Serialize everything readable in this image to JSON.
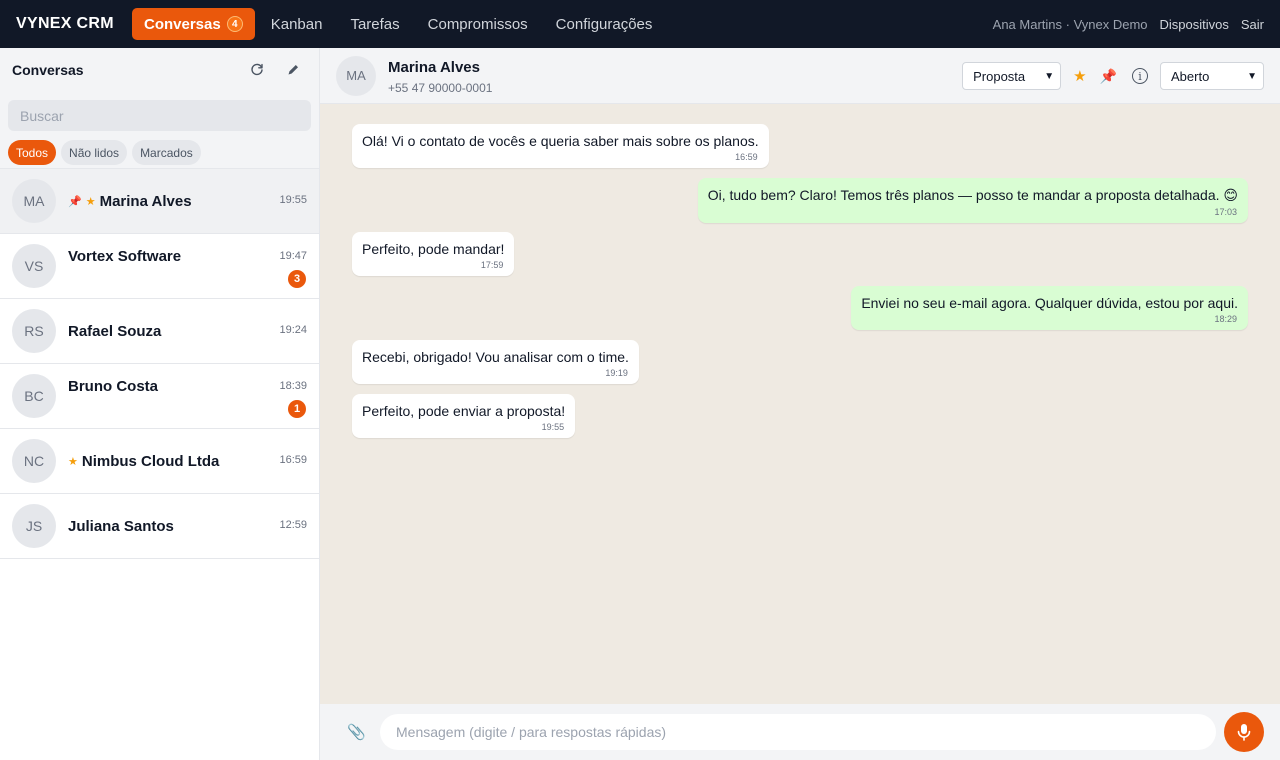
{
  "topbar": {
    "brand": "VYNEX CRM",
    "nav": [
      {
        "label": "Conversas",
        "badge": "4"
      },
      {
        "label": "Kanban"
      },
      {
        "label": "Tarefas"
      },
      {
        "label": "Compromissos"
      },
      {
        "label": "Configurações"
      }
    ],
    "user": "Ana Martins · Vynex Demo",
    "devices": "Dispositivos",
    "logout": "Sair"
  },
  "sidebar": {
    "title": "Conversas",
    "search_placeholder": "Buscar",
    "filters": [
      "Todos",
      "Não lidos",
      "Marcados"
    ],
    "conversations": [
      {
        "initials": "MA",
        "name": "Marina Alves",
        "time": "19:55",
        "pinned": true,
        "starred": true
      },
      {
        "initials": "VS",
        "name": "Vortex Software",
        "time": "19:47",
        "unread": "3"
      },
      {
        "initials": "RS",
        "name": "Rafael Souza",
        "time": "19:24"
      },
      {
        "initials": "BC",
        "name": "Bruno Costa",
        "time": "18:39",
        "unread": "1"
      },
      {
        "initials": "NC",
        "name": "Nimbus Cloud Ltda",
        "time": "16:59",
        "starred": true
      },
      {
        "initials": "JS",
        "name": "Juliana Santos",
        "time": "12:59"
      }
    ]
  },
  "chat": {
    "contact": {
      "initials": "MA",
      "name": "Marina Alves",
      "phone": "+55 47 90000-0001"
    },
    "stage": "Proposta",
    "status": "Aberto",
    "messages": [
      {
        "dir": "in",
        "text": "Olá! Vi o contato de vocês e queria saber mais sobre os planos.",
        "time": "16:59"
      },
      {
        "dir": "out",
        "text": "Oi, tudo bem? Claro! Temos três planos — posso te mandar a proposta detalhada. 😊",
        "time": "17:03"
      },
      {
        "dir": "in",
        "text": "Perfeito, pode mandar!",
        "time": "17:59"
      },
      {
        "dir": "out",
        "text": "Enviei no seu e-mail agora. Qualquer dúvida, estou por aqui.",
        "time": "18:29"
      },
      {
        "dir": "in",
        "text": "Recebi, obrigado! Vou analisar com o time.",
        "time": "19:19"
      },
      {
        "dir": "in",
        "text": "Perfeito, pode enviar a proposta!",
        "time": "19:55"
      }
    ],
    "composer_placeholder": "Mensagem (digite / para respostas rápidas)"
  },
  "colors": {
    "accent": "#ea580c",
    "topbar": "#111827",
    "outgoing": "#d9fdd3",
    "chat_bg": "#efeae2"
  }
}
